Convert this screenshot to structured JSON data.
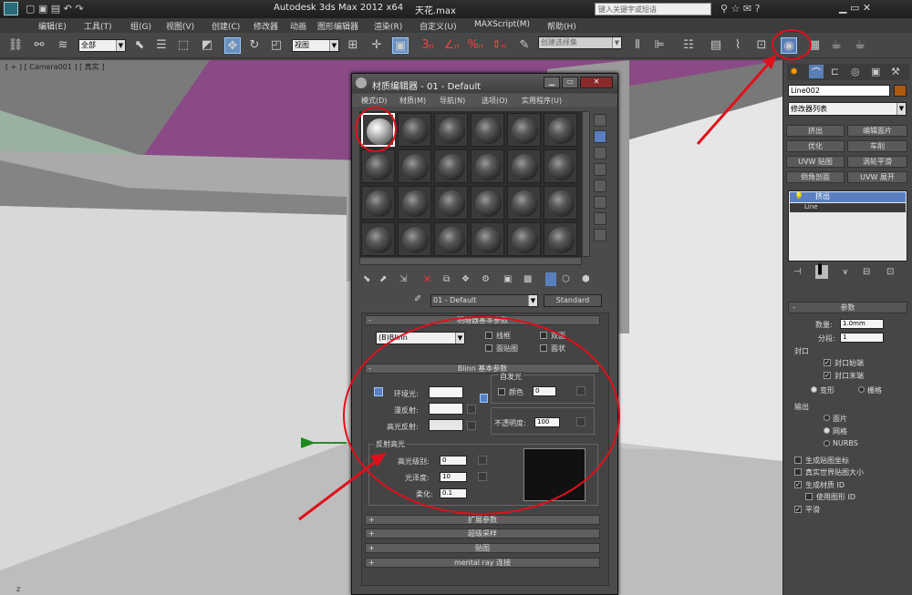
{
  "window": {
    "title": "Autodesk 3ds Max  2012 x64",
    "file": "天花.max",
    "search_placeholder": "键入关键字或短语"
  },
  "menubar": {
    "items": [
      "编辑(E)",
      "工具(T)",
      "组(G)",
      "视图(V)",
      "创建(C)",
      "修改器",
      "动画",
      "图形编辑器",
      "渲染(R)",
      "自定义(U)",
      "MAXScript(M)",
      "帮助(H)"
    ]
  },
  "toolbar": {
    "selection_filter": "全部",
    "ref_coord": "视图",
    "named_selection": "创建选择集"
  },
  "viewport": {
    "label": "[ + ] [ Camera001 ] [ 真实 ]",
    "axis_label": "z"
  },
  "command_panel": {
    "object_name": "Line002",
    "modifier_list": "修改器列表",
    "modifier_buttons": [
      "挤出",
      "编辑面片",
      "优化",
      "车削",
      "UVW 贴图",
      "涡轮平滑",
      "倒角剖面",
      "UVW 展开"
    ],
    "stack": [
      "挤出",
      "Line"
    ],
    "params": {
      "header": "参数",
      "amount_label": "数量:",
      "amount": "1.0mm",
      "segments_label": "分段:",
      "segments": "1",
      "capping_group": "封口",
      "cap_start": "封口始端",
      "cap_end": "封口末端",
      "morph": "变形",
      "grid": "栅格",
      "output_group": "输出",
      "out_patch": "面片",
      "out_mesh": "网格",
      "out_nurbs": "NURBS",
      "gen_map": "生成贴图坐标",
      "real_world": "真实世界贴图大小",
      "gen_mat": "生成材质 ID",
      "use_shape": "使用图形 ID",
      "smooth": "平滑"
    }
  },
  "material_editor": {
    "title": "材质编辑器 - 01 - Default",
    "menu": [
      "模式(D)",
      "材质(M)",
      "导航(N)",
      "选项(O)",
      "实用程序(U)"
    ],
    "material_name": "01 - Default",
    "material_type": "Standard",
    "shader_basic": {
      "header": "明暗器基本参数",
      "shader": "(B)Blinn",
      "wire": "线框",
      "two_sided": "双面",
      "face_map": "面贴图",
      "faceted": "面状"
    },
    "blinn_basic": {
      "header": "Blinn 基本参数",
      "self_illum": "自发光",
      "color": "颜色",
      "color_value": "0",
      "ambient": "环境光:",
      "diffuse": "漫反射:",
      "specular": "高光反射:",
      "opacity_label": "不透明度:",
      "opacity": "100"
    },
    "spec_highlights": {
      "header": "反射高光",
      "level_label": "高光级别:",
      "level": "0",
      "gloss_label": "光泽度:",
      "gloss": "10",
      "soften_label": "柔化:",
      "soften": "0.1"
    },
    "rollouts": [
      "扩展参数",
      "超级采样",
      "贴图",
      "mental ray 连接"
    ]
  }
}
